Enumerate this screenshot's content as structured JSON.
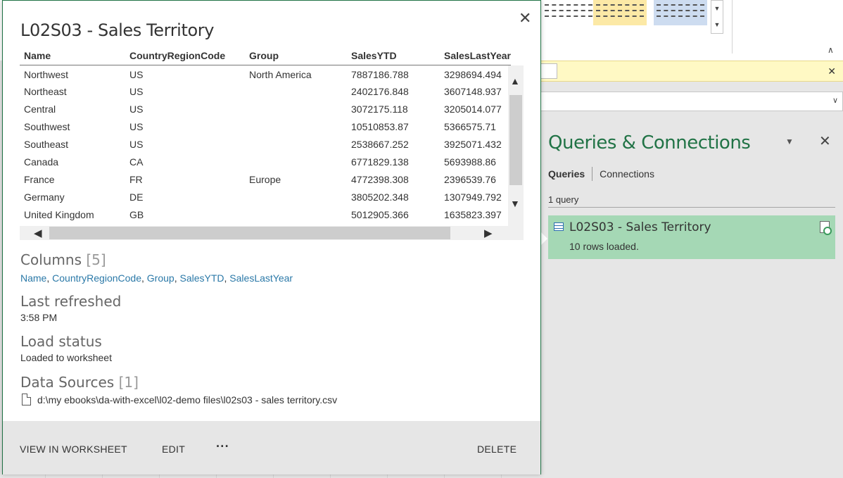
{
  "query_card": {
    "title": "L02S03 - Sales Territory",
    "close_icon": "✕",
    "preview": {
      "columns": [
        "Name",
        "CountryRegionCode",
        "Group",
        "SalesYTD",
        "SalesLastYear"
      ],
      "rows": [
        [
          "Northwest",
          "US",
          "North America",
          "7887186.788",
          "3298694.494"
        ],
        [
          "Northeast",
          "US",
          "",
          "2402176.848",
          "3607148.937"
        ],
        [
          "Central",
          "US",
          "",
          "3072175.118",
          "3205014.077"
        ],
        [
          "Southwest",
          "US",
          "",
          "10510853.87",
          "5366575.71"
        ],
        [
          "Southeast",
          "US",
          "",
          "2538667.252",
          "3925071.432"
        ],
        [
          "Canada",
          "CA",
          "",
          "6771829.138",
          "5693988.86"
        ],
        [
          "France",
          "FR",
          "Europe",
          "4772398.308",
          "2396539.76"
        ],
        [
          "Germany",
          "DE",
          "",
          "3805202.348",
          "1307949.792"
        ],
        [
          "United Kingdom",
          "GB",
          "",
          "5012905.366",
          "1635823.397"
        ]
      ]
    },
    "columns_section": {
      "heading": "Columns",
      "count": "[5]",
      "names": [
        "Name",
        "CountryRegionCode",
        "Group",
        "SalesYTD",
        "SalesLastYear"
      ],
      "separator": ", "
    },
    "last_refreshed": {
      "heading": "Last refreshed",
      "value": "3:58 PM"
    },
    "load_status": {
      "heading": "Load status",
      "value": "Loaded to worksheet"
    },
    "data_sources": {
      "heading": "Data Sources",
      "count": "[1]",
      "path": "d:\\my ebooks\\da-with-excel\\l02-demo files\\l02s03 - sales territory.csv"
    },
    "footer": {
      "view_label": "VIEW IN WORKSHEET",
      "edit_label": "EDIT",
      "more_label": "···",
      "delete_label": "DELETE"
    }
  },
  "queries_pane": {
    "title": "Queries & Connections",
    "close_icon": "✕",
    "dropdown_icon": "▼",
    "tabs": [
      {
        "label": "Queries",
        "active": true
      },
      {
        "label": "Connections",
        "active": false
      }
    ],
    "query_count": "1 query",
    "items": [
      {
        "name": "L02S03 - Sales Territory",
        "status": "10 rows loaded."
      }
    ]
  },
  "message_bar": {
    "close_icon": "✕"
  },
  "colors": {
    "accent": "#217346",
    "selected_item": "#a5d8b5",
    "link": "#2b79a8",
    "message_bar": "#fff9c4"
  },
  "icons": {
    "table": "table-icon",
    "refresh": "refresh-document-icon",
    "file": "file-icon",
    "scroll_up": "▲",
    "scroll_down": "▼",
    "scroll_left": "◀",
    "scroll_right": "▶"
  }
}
